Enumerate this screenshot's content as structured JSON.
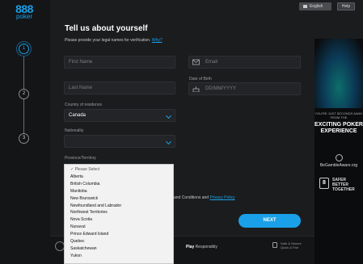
{
  "header": {
    "language_label": "English",
    "help_label": "Help"
  },
  "brand": {
    "logo_main": "888",
    "logo_sub": "poker"
  },
  "stepper": {
    "steps": [
      "1",
      "2",
      "3"
    ],
    "active_step": 1
  },
  "form": {
    "title": "Tell us about yourself",
    "subtitle": "Please provide your legal names for verification.",
    "why_link": "Why?",
    "first_name_placeholder": "First Name",
    "email_placeholder": "Email",
    "last_name_placeholder": "Last Name",
    "dob_label": "Date of Birth",
    "dob_placeholder": "DD/MM/YYYY",
    "country_label": "Country of residence",
    "country_value": "Canada",
    "nationality_label": "Nationality",
    "nationality_value": "",
    "province_label": "Province/Territory",
    "province_options": [
      "Please Select",
      "Alberta",
      "British Columbia",
      "Manitoba",
      "New Brunswick",
      "Newfoundland and Labrador",
      "Northwest Territories",
      "Nova Scotia",
      "Nunavut",
      "Prince Edward Island",
      "Quebec",
      "Saskatchewan",
      "Yukon"
    ],
    "terms_fragment": "and Conditions and",
    "privacy_link": "Privacy Policy",
    "next_label": "NEXT"
  },
  "footer": {
    "play_responsibly_brand": "Play",
    "play_responsibly_text": " Responsibly",
    "safe_text": "Safe & Secure Quick & Fair"
  },
  "ad": {
    "tagline": "YOU'RE JUST SECONDS AWAY FROM THE",
    "headline": "EXCITING POKER EXPERIENCE",
    "gamble_aware": "BeGambleAware.org",
    "safer_badge": "8",
    "safer_text": "SAFER BETTER TOGETHER"
  },
  "colors": {
    "accent": "#1aa0e8",
    "background": "#1b1c1e",
    "field": "#232427"
  }
}
